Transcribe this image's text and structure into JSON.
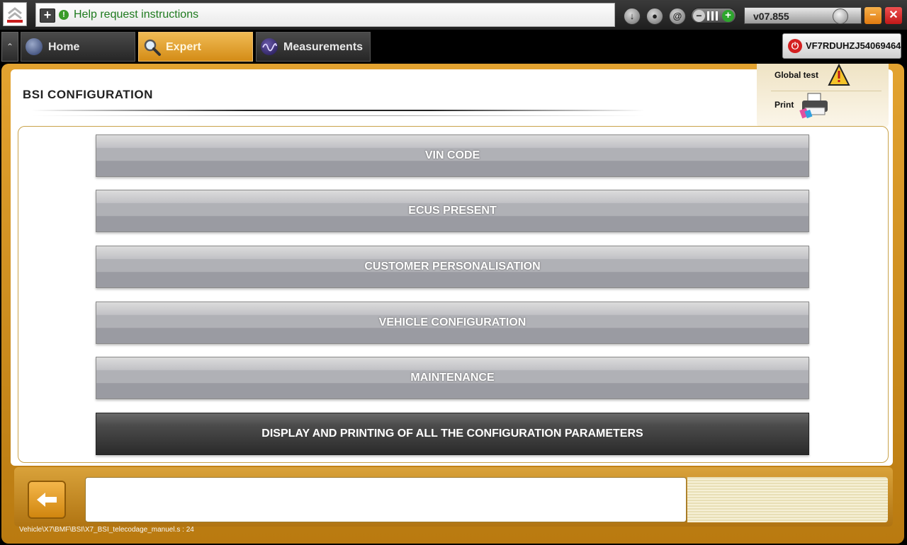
{
  "topbar": {
    "help_text": "Help request instructions",
    "version": "v07.855"
  },
  "tabs": [
    {
      "label": "Home"
    },
    {
      "label": "Expert"
    },
    {
      "label": "Measurements"
    }
  ],
  "vehicle": {
    "vin": "VF7RDUHZJ54069464"
  },
  "page": {
    "title": "BSI  CONFIGURATION"
  },
  "side_actions": {
    "global_test": "Global test",
    "print": "Print"
  },
  "menu": {
    "items": [
      {
        "label": "VIN CODE"
      },
      {
        "label": "ECUS PRESENT"
      },
      {
        "label": "CUSTOMER PERSONALISATION"
      },
      {
        "label": "VEHICLE CONFIGURATION"
      },
      {
        "label": "MAINTENANCE"
      },
      {
        "label": "DISPLAY AND PRINTING OF ALL THE CONFIGURATION PARAMETERS"
      }
    ]
  },
  "footer": {
    "path": "Vehicle\\X7\\BMF\\BSI\\X7_BSI_telecodage_manuel.s : 24"
  },
  "colors": {
    "accent": "#d48c16",
    "help_text": "#1e7a1e",
    "close_button": "#d42020"
  },
  "icons": {
    "logo": "citroen-logo-icon",
    "plus": "plus-icon",
    "info": "info-icon",
    "download": "download-icon",
    "user": "user-icon",
    "email": "at-icon",
    "volume": "volume-icon",
    "warning": "warning-icon",
    "printer": "printer-icon",
    "back": "back-arrow-icon"
  }
}
